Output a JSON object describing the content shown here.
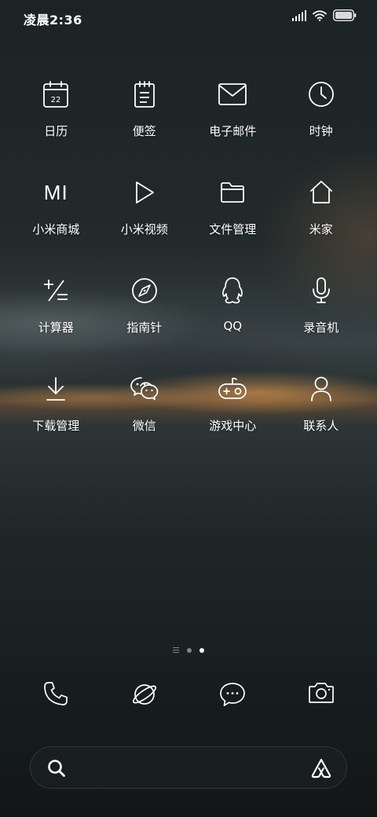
{
  "status_bar": {
    "time": "凌晨2:36",
    "icons": [
      "signal-icon",
      "wifi-icon",
      "battery-icon"
    ]
  },
  "apps": [
    {
      "label": "日历",
      "icon": "calendar-icon",
      "icon_text": "22"
    },
    {
      "label": "便签",
      "icon": "notes-icon"
    },
    {
      "label": "电子邮件",
      "icon": "mail-icon"
    },
    {
      "label": "时钟",
      "icon": "clock-icon"
    },
    {
      "label": "小米商城",
      "icon": "mi-store-icon",
      "icon_text": "MI"
    },
    {
      "label": "小米视频",
      "icon": "play-icon"
    },
    {
      "label": "文件管理",
      "icon": "folder-icon"
    },
    {
      "label": "米家",
      "icon": "home-icon"
    },
    {
      "label": "计算器",
      "icon": "calculator-icon"
    },
    {
      "label": "指南针",
      "icon": "compass-icon"
    },
    {
      "label": "QQ",
      "icon": "qq-penguin-icon"
    },
    {
      "label": "录音机",
      "icon": "microphone-icon"
    },
    {
      "label": "下载管理",
      "icon": "download-icon"
    },
    {
      "label": "微信",
      "icon": "wechat-icon"
    },
    {
      "label": "游戏中心",
      "icon": "gamepad-icon"
    },
    {
      "label": "联系人",
      "icon": "person-icon"
    }
  ],
  "page_indicator": {
    "pages": 3,
    "current": 3
  },
  "dock": [
    "phone-icon",
    "browser-planet-icon",
    "messages-icon",
    "camera-icon"
  ],
  "search_bar": {
    "left_icon": "search-icon",
    "right_icon": "assistant-icon"
  },
  "colors": {
    "icon": "#ffffff",
    "label": "#ffffff"
  }
}
